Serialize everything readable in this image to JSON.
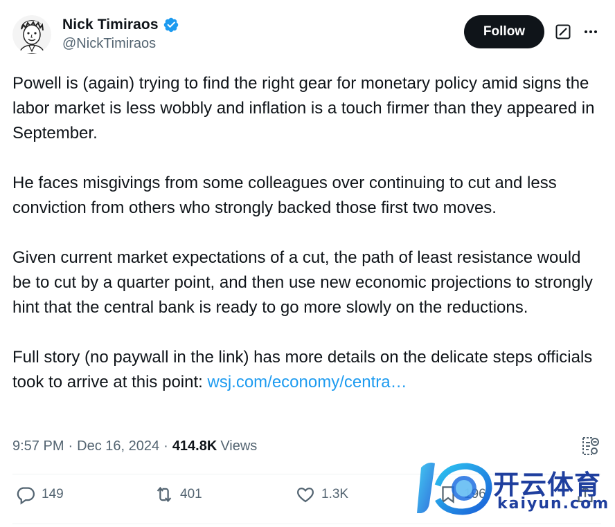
{
  "author": {
    "name": "Nick Timiraos",
    "handle": "@NickTimiraos",
    "verified": true
  },
  "header": {
    "follow_label": "Follow",
    "grok_icon": "grok-icon",
    "more_icon": "more-dots-icon"
  },
  "tweet": {
    "paragraphs": [
      "Powell is (again) trying to find the right gear for monetary policy amid signs the labor market is less wobbly and inflation is a touch firmer than they appeared in September.",
      "He faces misgivings from some colleagues over continuing to cut and less conviction from others who strongly backed those first two moves.",
      "Given current market expectations of a cut, the path of least resistance would be to cut by a quarter point, and then use new economic projections to strongly hint that the central bank is ready to go more slowly on the reductions."
    ],
    "last_paragraph_text": "Full story (no paywall in the link) has more details on the delicate steps officials took to arrive at this point: ",
    "link_text": "wsj.com/economy/centra…"
  },
  "meta": {
    "time": "9:57 PM",
    "date": "Dec 16, 2024",
    "views_count": "414.8K",
    "views_label": "Views",
    "dot": "·"
  },
  "actions": {
    "reply_count": "149",
    "retweet_count": "401",
    "like_count": "1.3K",
    "bookmark_count": "196"
  },
  "watermark": {
    "chinese_text": "开云体育",
    "domain_text": "kaiyun.com"
  },
  "colors": {
    "text": "#0f1419",
    "secondary": "#536471",
    "link": "#1d9bf0",
    "verified": "#1d9bf0",
    "follow_bg": "#0f1419"
  }
}
